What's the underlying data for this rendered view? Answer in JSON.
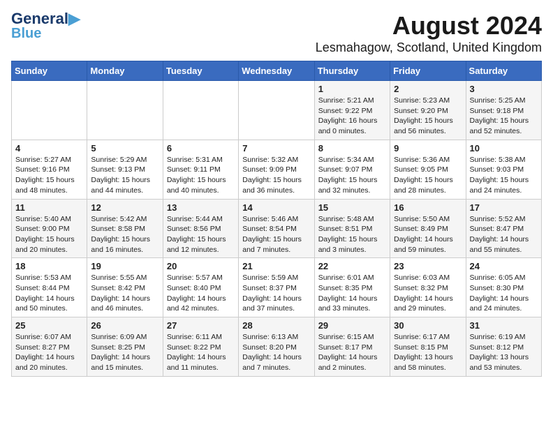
{
  "header": {
    "logo": {
      "line1": "General",
      "line2": "Blue"
    },
    "title": "August 2024",
    "subtitle": "Lesmahagow, Scotland, United Kingdom"
  },
  "days_of_week": [
    "Sunday",
    "Monday",
    "Tuesday",
    "Wednesday",
    "Thursday",
    "Friday",
    "Saturday"
  ],
  "weeks": [
    [
      {
        "day": "",
        "content": ""
      },
      {
        "day": "",
        "content": ""
      },
      {
        "day": "",
        "content": ""
      },
      {
        "day": "",
        "content": ""
      },
      {
        "day": "1",
        "content": "Sunrise: 5:21 AM\nSunset: 9:22 PM\nDaylight: 16 hours\nand 0 minutes."
      },
      {
        "day": "2",
        "content": "Sunrise: 5:23 AM\nSunset: 9:20 PM\nDaylight: 15 hours\nand 56 minutes."
      },
      {
        "day": "3",
        "content": "Sunrise: 5:25 AM\nSunset: 9:18 PM\nDaylight: 15 hours\nand 52 minutes."
      }
    ],
    [
      {
        "day": "4",
        "content": "Sunrise: 5:27 AM\nSunset: 9:16 PM\nDaylight: 15 hours\nand 48 minutes."
      },
      {
        "day": "5",
        "content": "Sunrise: 5:29 AM\nSunset: 9:13 PM\nDaylight: 15 hours\nand 44 minutes."
      },
      {
        "day": "6",
        "content": "Sunrise: 5:31 AM\nSunset: 9:11 PM\nDaylight: 15 hours\nand 40 minutes."
      },
      {
        "day": "7",
        "content": "Sunrise: 5:32 AM\nSunset: 9:09 PM\nDaylight: 15 hours\nand 36 minutes."
      },
      {
        "day": "8",
        "content": "Sunrise: 5:34 AM\nSunset: 9:07 PM\nDaylight: 15 hours\nand 32 minutes."
      },
      {
        "day": "9",
        "content": "Sunrise: 5:36 AM\nSunset: 9:05 PM\nDaylight: 15 hours\nand 28 minutes."
      },
      {
        "day": "10",
        "content": "Sunrise: 5:38 AM\nSunset: 9:03 PM\nDaylight: 15 hours\nand 24 minutes."
      }
    ],
    [
      {
        "day": "11",
        "content": "Sunrise: 5:40 AM\nSunset: 9:00 PM\nDaylight: 15 hours\nand 20 minutes."
      },
      {
        "day": "12",
        "content": "Sunrise: 5:42 AM\nSunset: 8:58 PM\nDaylight: 15 hours\nand 16 minutes."
      },
      {
        "day": "13",
        "content": "Sunrise: 5:44 AM\nSunset: 8:56 PM\nDaylight: 15 hours\nand 12 minutes."
      },
      {
        "day": "14",
        "content": "Sunrise: 5:46 AM\nSunset: 8:54 PM\nDaylight: 15 hours\nand 7 minutes."
      },
      {
        "day": "15",
        "content": "Sunrise: 5:48 AM\nSunset: 8:51 PM\nDaylight: 15 hours\nand 3 minutes."
      },
      {
        "day": "16",
        "content": "Sunrise: 5:50 AM\nSunset: 8:49 PM\nDaylight: 14 hours\nand 59 minutes."
      },
      {
        "day": "17",
        "content": "Sunrise: 5:52 AM\nSunset: 8:47 PM\nDaylight: 14 hours\nand 55 minutes."
      }
    ],
    [
      {
        "day": "18",
        "content": "Sunrise: 5:53 AM\nSunset: 8:44 PM\nDaylight: 14 hours\nand 50 minutes."
      },
      {
        "day": "19",
        "content": "Sunrise: 5:55 AM\nSunset: 8:42 PM\nDaylight: 14 hours\nand 46 minutes."
      },
      {
        "day": "20",
        "content": "Sunrise: 5:57 AM\nSunset: 8:40 PM\nDaylight: 14 hours\nand 42 minutes."
      },
      {
        "day": "21",
        "content": "Sunrise: 5:59 AM\nSunset: 8:37 PM\nDaylight: 14 hours\nand 37 minutes."
      },
      {
        "day": "22",
        "content": "Sunrise: 6:01 AM\nSunset: 8:35 PM\nDaylight: 14 hours\nand 33 minutes."
      },
      {
        "day": "23",
        "content": "Sunrise: 6:03 AM\nSunset: 8:32 PM\nDaylight: 14 hours\nand 29 minutes."
      },
      {
        "day": "24",
        "content": "Sunrise: 6:05 AM\nSunset: 8:30 PM\nDaylight: 14 hours\nand 24 minutes."
      }
    ],
    [
      {
        "day": "25",
        "content": "Sunrise: 6:07 AM\nSunset: 8:27 PM\nDaylight: 14 hours\nand 20 minutes."
      },
      {
        "day": "26",
        "content": "Sunrise: 6:09 AM\nSunset: 8:25 PM\nDaylight: 14 hours\nand 15 minutes."
      },
      {
        "day": "27",
        "content": "Sunrise: 6:11 AM\nSunset: 8:22 PM\nDaylight: 14 hours\nand 11 minutes."
      },
      {
        "day": "28",
        "content": "Sunrise: 6:13 AM\nSunset: 8:20 PM\nDaylight: 14 hours\nand 7 minutes."
      },
      {
        "day": "29",
        "content": "Sunrise: 6:15 AM\nSunset: 8:17 PM\nDaylight: 14 hours\nand 2 minutes."
      },
      {
        "day": "30",
        "content": "Sunrise: 6:17 AM\nSunset: 8:15 PM\nDaylight: 13 hours\nand 58 minutes."
      },
      {
        "day": "31",
        "content": "Sunrise: 6:19 AM\nSunset: 8:12 PM\nDaylight: 13 hours\nand 53 minutes."
      }
    ]
  ]
}
